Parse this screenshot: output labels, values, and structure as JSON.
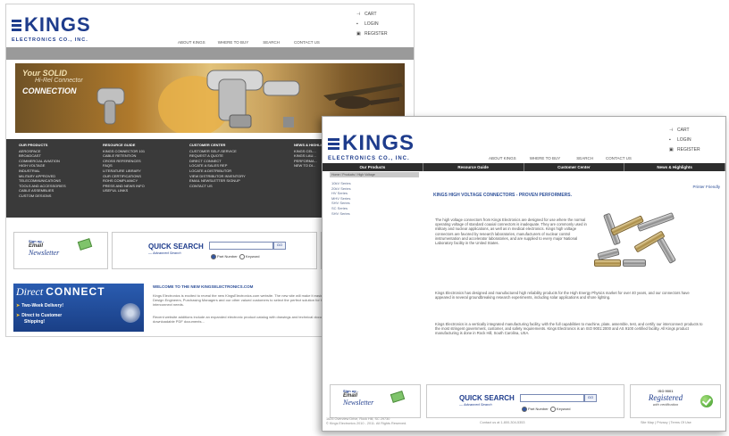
{
  "brand": {
    "name": "KINGS",
    "subtitle": "ELECTRONICS CO., INC.",
    "color": "#1e3c8c"
  },
  "utility_links": [
    {
      "icon": "cart-icon",
      "label": "CART"
    },
    {
      "icon": "login-icon",
      "label": "LOGIN"
    },
    {
      "icon": "register-icon",
      "label": "REGISTER"
    }
  ],
  "top_nav": [
    "ABOUT KINGS",
    "WHERE TO BUY",
    "SEARCH",
    "CONTACT US"
  ],
  "hero": {
    "line1": "Your SOLID",
    "line2": "Hi-Rel Connector",
    "line3": "CONNECTION"
  },
  "sitemap": [
    {
      "heading": "OUR PRODUCTS",
      "items": [
        "AEROSPACE",
        "BROADCAST",
        "COMMERCIAL AVIATION",
        "HIGH VOLTAGE",
        "INDUSTRIAL",
        "MILITARY APPROVED",
        "TELECOMMUNICATIONS",
        "TOOLS AND ACCESSORIES",
        "CABLE ASSEMBLIES",
        "CUSTOM DESIGNS"
      ]
    },
    {
      "heading": "RESOURCE GUIDE",
      "items": [
        "KINGS CONNECTOR 101",
        "CABLE RETENTION",
        "CROSS REFERENCES",
        "FAQS",
        "LITERATURE LIBRARY",
        "OUR CERTIFICATIONS",
        "ROHS COMPLIANCY",
        "PRESS AND NEWS INFO",
        "USEFUL LINKS"
      ]
    },
    {
      "heading": "CUSTOMER CENTER",
      "items": [
        "CUSTOMER SELF-SERVICE",
        "REQUEST A QUOTE",
        "DIRECT CONNECT",
        "LOCATE A SALES REP",
        "LOCATE A DISTRIBUTOR",
        "VIEW DISTRIBUTOR INVENTORY",
        "EMAIL NEWSLETTER SIGNUP",
        "CONTACT US"
      ]
    },
    {
      "heading": "NEWS & HIGHLIGHTS",
      "items": [
        "KINGS CEL...",
        "KINGS LAU...",
        "PERFORMA...",
        "NEW TO DI..."
      ]
    }
  ],
  "newsletter": {
    "line1": "Sign up -",
    "line2": "Email",
    "line3": "Newsletter"
  },
  "quick_search": {
    "title": "QUICK SEARCH",
    "subtitle": "— Advanced Search",
    "go": "GO",
    "options": [
      "Part Number",
      "Keyword"
    ]
  },
  "direct_connect": {
    "title_a": "Direct",
    "title_b": "CONNECT",
    "rows": [
      "Two-Week Delivery!",
      "Direct to Customer",
      "Shipping!"
    ]
  },
  "welcome": {
    "heading": "WELCOME TO THE NEW KINGSELECTRONICS.COM",
    "p1": "Kings Electronics is excited to reveal the new KingsElectronics.com website. The new site will make it easier for Design Engineers, Purchasing Managers and our other valued customers to select the perfect solution for their interconnect needs.",
    "p2": "Recent website additions include an expanded electronic product catalog with drawings and technical documents, downloadable PDF documents..."
  },
  "page_b": {
    "nav": [
      "Our Products",
      "Resource Guide",
      "Customer Center",
      "News & Highlights"
    ],
    "breadcrumb": "Home / Products / High Voltage",
    "sidebar": [
      "10kV Series",
      "20kV Series",
      "HV Series",
      "MHV Series",
      "SHV Series",
      "SC Series",
      "SHV Series"
    ],
    "print_link": "Printer Friendly",
    "heading": "KINGS HIGH VOLTAGE CONNECTORS - PROVEN PERFORMERS.",
    "p1": "The high voltage connectors from Kings Electronics are designed for use where the normal operating voltage of standard coaxial connectors is inadequate. They are commonly used in military and nuclear applications, as well as in medical electronics. Kings high voltage connectors are favored by research laboratories, manufacturers of nuclear control instrumentation and accelerator laboratories, and are supplied to every major National Laboratory facility in the United States.",
    "p2": "Kings Electronics has designed and manufactured high reliability products for the High Energy Physics market for over 40 years, and our connectors have appeared in several groundbreaking research experiments, including solar applications and shore lighting.",
    "p3": "Kings Electronics is a vertically integrated manufacturing facility, with the full capabilities to machine, plate, assemble, test, and certify our interconnect products to the most stringent government, customer, and safety requirements. Kings Electronics is an ISO 9001:2000 and AS 9100 certified facility. All Kings product manufacturing is done in Rock Hill, South Carolina, USA.",
    "registered": {
      "line1": "ISO 9001",
      "line2": "Registered",
      "line3": "with certification"
    },
    "footer_left_1": "1625 Overview Drive, Rock Hill, SC 29730",
    "footer_left_2": "© Kings Electronics 2010 - 2011. All Rights Reserved.",
    "footer_mid": "Contact us at 1-800-304-5353",
    "footer_right": "Site Map | Privacy | Terms Of Use"
  }
}
